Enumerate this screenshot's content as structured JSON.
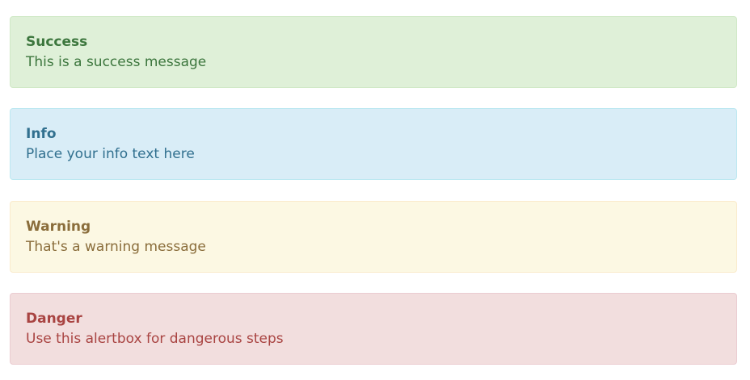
{
  "alerts": [
    {
      "kind": "success",
      "title": "Success",
      "text": "This is a success message",
      "bg": "#dff0d8",
      "border": "#d0e9c6",
      "color": "#3c763d"
    },
    {
      "kind": "info",
      "title": "Info",
      "text": "Place your info text here",
      "bg": "#d9edf7",
      "border": "#bce8f1",
      "color": "#31708f"
    },
    {
      "kind": "warning",
      "title": "Warning",
      "text": "That's a warning message",
      "bg": "#fcf8e3",
      "border": "#faebcc",
      "color": "#8a6d3b"
    },
    {
      "kind": "danger",
      "title": "Danger",
      "text": "Use this alertbox for dangerous steps",
      "bg": "#f2dede",
      "border": "#ebccd1",
      "color": "#a94442"
    }
  ]
}
